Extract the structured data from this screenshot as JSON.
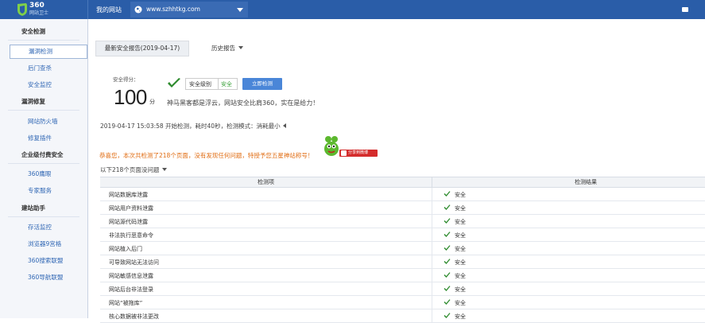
{
  "header": {
    "logo_text": "360",
    "logo_sub": "网站卫士",
    "my_site": "我的网站",
    "site_url": "www.szhhtkg.com"
  },
  "sidebar": {
    "sections": [
      {
        "title": "安全检测",
        "items": [
          "漏洞检测",
          "后门查杀",
          "安全监控"
        ]
      },
      {
        "title": "漏洞修复",
        "items": [
          "网站防火墙",
          "修复插件"
        ]
      },
      {
        "title": "企业级付费安全",
        "items": [
          "360鹰眼",
          "专家服务"
        ]
      },
      {
        "title": "建站助手",
        "items": [
          "存活监控",
          "浏览器9宫格",
          "360搜索联盟",
          "360导航联盟"
        ]
      }
    ],
    "active_item": "漏洞检测"
  },
  "main": {
    "tab_latest": "最新安全报告(2019-04-17)",
    "tab_history": "历史报告",
    "score_label": "安全得分：",
    "score": "100",
    "score_unit": "分",
    "level_label": "安全级别",
    "level_value": "安全",
    "scan_button": "立即检测",
    "slogan": "神马黑客都是浮云，网站安全比肩360，实在是给力！",
    "scan_info": "2019-04-17 15:03:58 开始检测，耗时40秒，检测模式：消耗最小",
    "result_message": "恭喜您，本次共检测了218个页面，没有发现任何问题，特授予您五星神站称号！",
    "share_label": "分享到微博",
    "pages_scanned": "以下218个页面没问题",
    "table": {
      "col_item": "检测项",
      "col_result": "检测结果",
      "rows": [
        {
          "name": "网站数据库泄露",
          "result": "安全"
        },
        {
          "name": "网站用户资料泄露",
          "result": "安全"
        },
        {
          "name": "网站源代码泄露",
          "result": "安全"
        },
        {
          "name": "非法执行恶意命令",
          "result": "安全"
        },
        {
          "name": "网站植入后门",
          "result": "安全"
        },
        {
          "name": "可导致网站无法访问",
          "result": "安全"
        },
        {
          "name": "网站敏感信息泄露",
          "result": "安全"
        },
        {
          "name": "网站后台非法登录",
          "result": "安全"
        },
        {
          "name": "网站“被拖库”",
          "result": "安全"
        },
        {
          "name": "核心数据被非法更改",
          "result": "安全"
        }
      ]
    }
  },
  "colors": {
    "topbar": "#2a5da8",
    "link": "#2f66b4",
    "safe_green": "#3aa13a",
    "warning_orange": "#e06b10",
    "button_blue": "#4a86d8"
  }
}
